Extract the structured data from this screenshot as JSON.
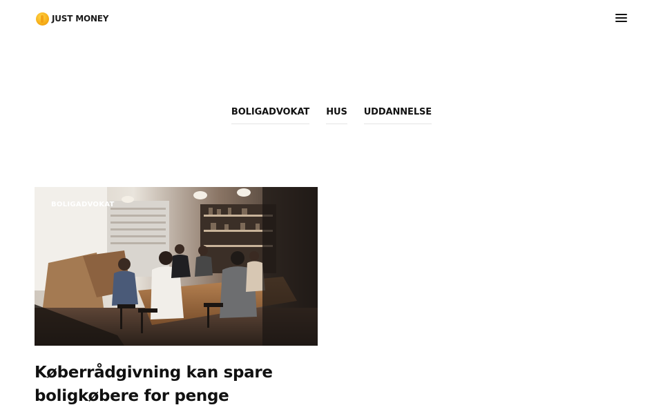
{
  "header": {
    "logo_text": "JUST MONEY",
    "menu_icon": "hamburger-menu-icon"
  },
  "tags": [
    {
      "label": "BOLIGADVOKAT"
    },
    {
      "label": "HUS"
    },
    {
      "label": "UDDANNELSE"
    }
  ],
  "article": {
    "category": "BOLIGADVOKAT",
    "title": "Køberrådgivning kan spare boligkøbere for penge"
  },
  "colors": {
    "text": "#111111",
    "background": "#ffffff",
    "logo_coin": "#f7b11a"
  }
}
